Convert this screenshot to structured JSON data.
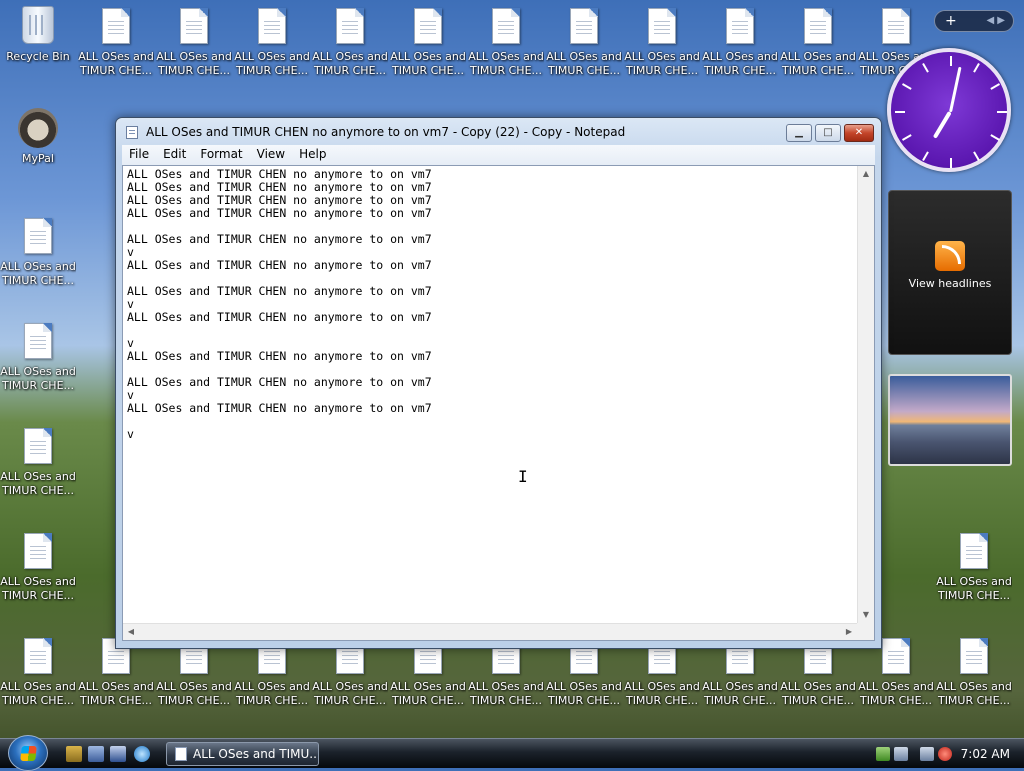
{
  "desktop": {
    "recycle_bin_label": "Recycle Bin",
    "mypal_label": "MyPal",
    "doc_icon_label_line1": "ALL OSes and",
    "doc_icon_label_line2": "TIMUR CHE..."
  },
  "gadgets": {
    "rss_label": "View headlines",
    "clock_time": "7:02"
  },
  "notepad": {
    "title": "ALL OSes and TIMUR CHEN no anymore to on vm7 - Copy (22) - Copy - Notepad",
    "menu": [
      "File",
      "Edit",
      "Format",
      "View",
      "Help"
    ],
    "content": "ALL OSes and TIMUR CHEN no anymore to on vm7\nALL OSes and TIMUR CHEN no anymore to on vm7\nALL OSes and TIMUR CHEN no anymore to on vm7\nALL OSes and TIMUR CHEN no anymore to on vm7\n\nALL OSes and TIMUR CHEN no anymore to on vm7\nv\nALL OSes and TIMUR CHEN no anymore to on vm7\n\nALL OSes and TIMUR CHEN no anymore to on vm7\nv\nALL OSes and TIMUR CHEN no anymore to on vm7\n\nv\nALL OSes and TIMUR CHEN no anymore to on vm7\n\nALL OSes and TIMUR CHEN no anymore to on vm7\nv\nALL OSes and TIMUR CHEN no anymore to on vm7\n\nv"
  },
  "taskbar": {
    "task_button_label": "ALL OSes and TIMU...",
    "clock": "7:02 AM"
  }
}
